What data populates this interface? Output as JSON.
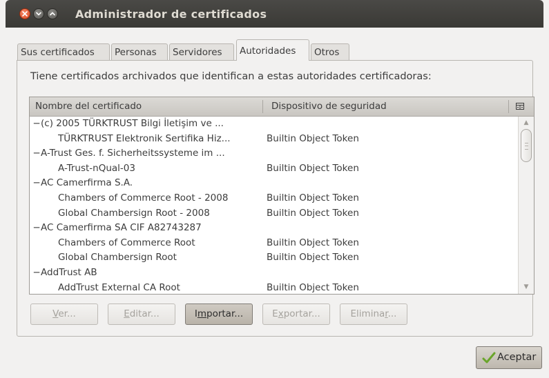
{
  "window": {
    "title": "Administrador de certificados"
  },
  "tabs": [
    {
      "label": "Sus certificados",
      "active": false
    },
    {
      "label": "Personas",
      "active": false
    },
    {
      "label": "Servidores",
      "active": false
    },
    {
      "label": "Autoridades",
      "active": true
    },
    {
      "label": "Otros",
      "active": false
    }
  ],
  "description": "Tiene certificados archivados que identifican a estas autoridades certificadoras:",
  "tree": {
    "columns": [
      "Nombre del certificado",
      "Dispositivo de seguridad"
    ],
    "rows": [
      {
        "type": "group",
        "expander": "−",
        "name": "(c) 2005 TÜRKTRUST Bilgi İletişim ve ...",
        "token": ""
      },
      {
        "type": "child",
        "expander": "",
        "name": "TÜRKTRUST Elektronik Sertifika Hiz...",
        "token": "Builtin Object Token"
      },
      {
        "type": "group",
        "expander": "−",
        "name": "A-Trust Ges. f. Sicherheitssysteme im ...",
        "token": ""
      },
      {
        "type": "child",
        "expander": "",
        "name": "A-Trust-nQual-03",
        "token": "Builtin Object Token"
      },
      {
        "type": "group",
        "expander": "−",
        "name": "AC Camerfirma S.A.",
        "token": ""
      },
      {
        "type": "child",
        "expander": "",
        "name": "Chambers of Commerce Root - 2008",
        "token": "Builtin Object Token"
      },
      {
        "type": "child",
        "expander": "",
        "name": "Global Chambersign Root - 2008",
        "token": "Builtin Object Token"
      },
      {
        "type": "group",
        "expander": "−",
        "name": "AC Camerfirma SA CIF A82743287",
        "token": ""
      },
      {
        "type": "child",
        "expander": "",
        "name": "Chambers of Commerce Root",
        "token": "Builtin Object Token"
      },
      {
        "type": "child",
        "expander": "",
        "name": "Global Chambersign Root",
        "token": "Builtin Object Token"
      },
      {
        "type": "group",
        "expander": "−",
        "name": "AddTrust AB",
        "token": ""
      },
      {
        "type": "child",
        "expander": "",
        "name": "AddTrust External CA Root",
        "token": "Builtin Object Token"
      }
    ]
  },
  "buttons": {
    "view": {
      "pre": "",
      "key": "V",
      "post": "er..."
    },
    "edit": {
      "pre": "",
      "key": "E",
      "post": "ditar..."
    },
    "import": {
      "pre": "I",
      "key": "m",
      "post": "portar..."
    },
    "export": {
      "pre": "E",
      "key": "x",
      "post": "portar..."
    },
    "delete": {
      "pre": "Elimina",
      "key": "r",
      "post": "..."
    }
  },
  "accept": {
    "label": "Aceptar",
    "icon": "check-icon"
  },
  "colors": {
    "titlebar": "#3c3b37",
    "accent_close": "#e05a2f",
    "check": "#6aa52b"
  }
}
